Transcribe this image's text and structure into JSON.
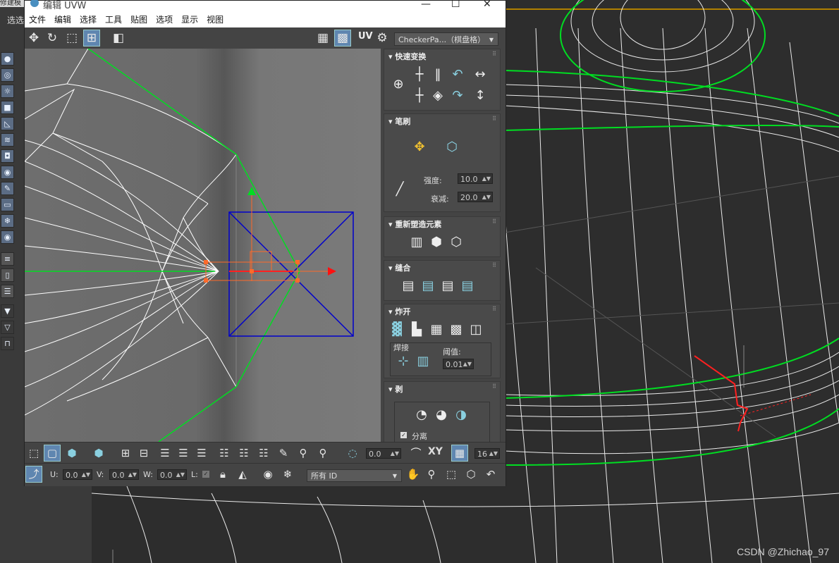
{
  "window": {
    "title": "编辑 UVW",
    "min": "—",
    "max": "☐",
    "close": "✕"
  },
  "menu": [
    "文件",
    "编辑",
    "选择",
    "工具",
    "贴图",
    "选项",
    "显示",
    "视图"
  ],
  "background": {
    "top_strip_text": "修建模",
    "select_label": "选选",
    "watermark": "CSDN @Zhichao_97"
  },
  "toolbar": {
    "uv_label": "UV",
    "texture_select": "CheckerPa...（棋盘格）",
    "dropdown_arrow": "▼"
  },
  "panel": {
    "quick_transform": {
      "title": "快速变换"
    },
    "brush": {
      "title": "笔刷",
      "strength_label": "强度:",
      "strength_value": "10.0",
      "falloff_label": "衰减:",
      "falloff_value": "20.0"
    },
    "reshape": {
      "title": "重新塑造元素"
    },
    "stitch": {
      "title": "缝合"
    },
    "explode": {
      "title": "炸开",
      "weld_label": "焊接",
      "threshold_label": "阈值:",
      "threshold_value": "0.01"
    },
    "peel": {
      "title": "剥",
      "detach_label": "分离",
      "detach_checked": true
    }
  },
  "bottom1": {
    "angle_value": "0.0",
    "xy_label": "XY",
    "grid_value": "16"
  },
  "bottom2": {
    "u_label": "U:",
    "u_value": "0.0",
    "v_label": "V:",
    "v_value": "0.0",
    "w_label": "W:",
    "w_value": "0.0",
    "l_label": "L:",
    "id_select": "所有 ID"
  },
  "colors": {
    "accent": "#5f86b0",
    "wire": "#ffffff",
    "seam": "#00cc22",
    "gizmo_blue": "#0000cc",
    "gizmo_red": "#ff2020"
  }
}
